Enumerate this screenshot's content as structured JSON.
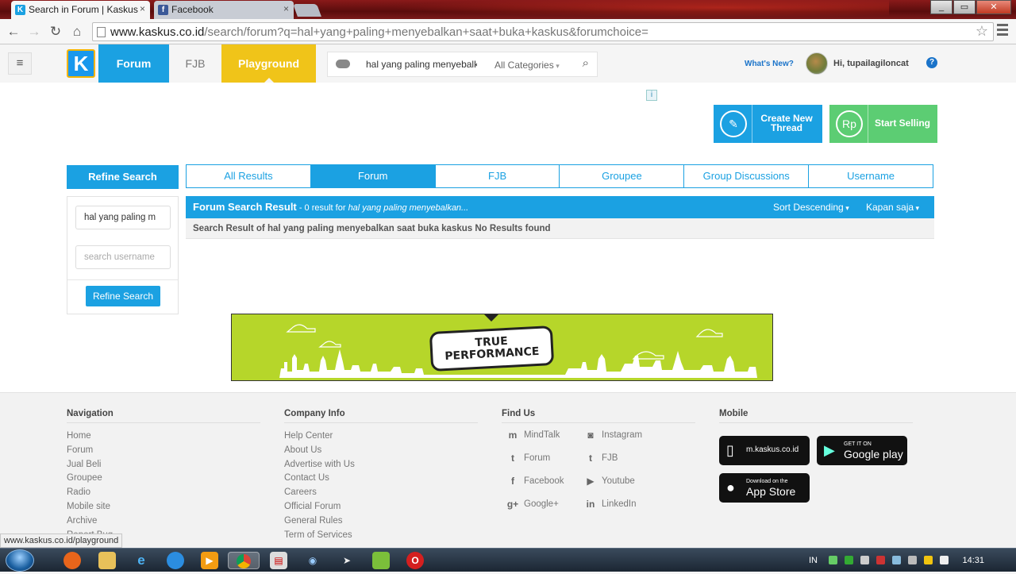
{
  "browser": {
    "tabs": [
      {
        "title": "Search in Forum | Kaskus -",
        "active": true,
        "favicon": "kaskus-favicon"
      },
      {
        "title": "Facebook",
        "active": false,
        "favicon": "facebook-favicon"
      }
    ],
    "url_host": "www.kaskus.co.id",
    "url_path": "/search/forum?q=hal+yang+paling+menyebalkan+saat+buka+kaskus&forumchoice=",
    "status_url": "www.kaskus.co.id/playground"
  },
  "header": {
    "logo": "K",
    "nav": {
      "forum": "Forum",
      "fjb": "FJB",
      "playground": "Playground"
    },
    "search": {
      "query": "hal yang paling menyebalk",
      "category": "All Categories"
    },
    "whats_new": "What's New?",
    "greeting": "Hi, tupailagiloncat",
    "help": "?"
  },
  "actions": {
    "ad_info": "i",
    "create_thread": "Create New Thread",
    "start_selling": "Start Selling",
    "rp_icon": "Rp"
  },
  "refine": {
    "title": "Refine Search",
    "query_value": "hal yang paling m",
    "username_placeholder": "search username",
    "button": "Refine Search"
  },
  "search_tabs": [
    "All Results",
    "Forum",
    "FJB",
    "Groupee",
    "Group Discussions",
    "Username"
  ],
  "active_tab": "Forum",
  "results": {
    "title": "Forum Search Result",
    "count": " - 0 result for ",
    "query": "hal yang paling menyebalkan...",
    "sort": "Sort Descending",
    "time": "Kapan saja",
    "message": "Search Result of hal yang paling menyebalkan saat buka kaskus No Results found"
  },
  "banner": {
    "line1": "TRUE",
    "line2": "PERFORMANCE"
  },
  "footer": {
    "navigation": {
      "title": "Navigation",
      "links": [
        "Home",
        "Forum",
        "Jual Beli",
        "Groupee",
        "Radio",
        "Mobile site",
        "Archive",
        "Report Bug"
      ]
    },
    "company": {
      "title": "Company Info",
      "links": [
        "Help Center",
        "About Us",
        "Advertise with Us",
        "Contact Us",
        "Careers",
        "Official Forum",
        "General Rules",
        "Term of Services"
      ]
    },
    "find_us": {
      "title": "Find Us",
      "left": [
        {
          "label": "MindTalk",
          "icon": "mindtalk-icon"
        },
        {
          "label": "Forum",
          "icon": "twitter-icon"
        },
        {
          "label": "Facebook",
          "icon": "facebook-icon"
        },
        {
          "label": "Google+",
          "icon": "google-plus-icon"
        }
      ],
      "right": [
        {
          "label": "Instagram",
          "icon": "instagram-icon"
        },
        {
          "label": "FJB",
          "icon": "twitter-icon"
        },
        {
          "label": "Youtube",
          "icon": "youtube-icon"
        },
        {
          "label": "LinkedIn",
          "icon": "linkedin-icon"
        }
      ]
    },
    "mobile": {
      "title": "Mobile",
      "mkaskus": "m.kaskus.co.id",
      "gplay_small": "GET IT ON",
      "gplay": "Google play",
      "appstore_small": "Download on the",
      "appstore": "App Store"
    }
  },
  "taskbar": {
    "lang": "IN",
    "time": "14:31"
  },
  "colors": {
    "kaskus_blue": "#1ba1e2",
    "playground_yellow": "#f0c419",
    "sell_green": "#5ccd73",
    "banner_green": "#b6d62a"
  }
}
